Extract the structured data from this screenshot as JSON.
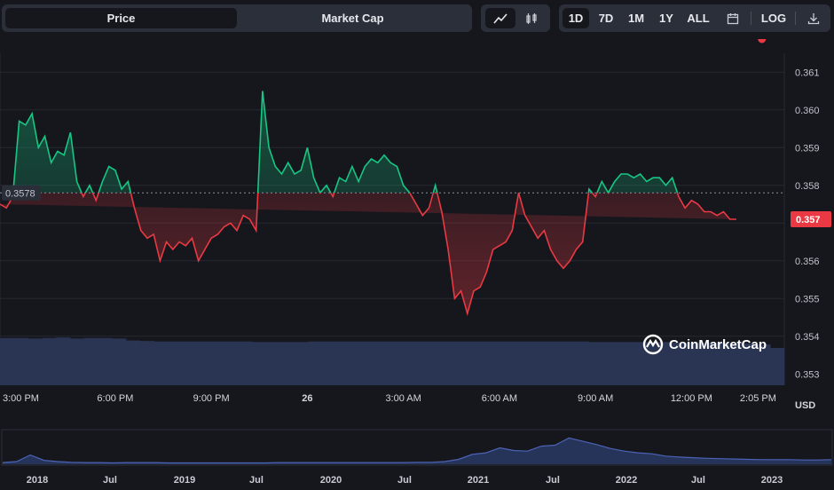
{
  "toolbar": {
    "price_tab": "Price",
    "market_cap_tab": "Market Cap",
    "range_buttons": [
      "1D",
      "7D",
      "1M",
      "1Y",
      "ALL"
    ],
    "active_range": "1D",
    "log_label": "LOG",
    "icons": [
      "line-chart-icon",
      "candlestick-icon",
      "calendar-icon",
      "download-icon"
    ]
  },
  "chart_data": {
    "type": "line",
    "ylim": [
      0.3527,
      0.3615
    ],
    "y_ticks": [
      "0.353",
      "0.354",
      "0.355",
      "0.356",
      "0.357",
      "0.358",
      "0.359",
      "0.360",
      "0.361"
    ],
    "y_tick_values": [
      0.353,
      0.354,
      0.355,
      0.356,
      0.357,
      0.358,
      0.359,
      0.36,
      0.361
    ],
    "x_tick_labels": [
      "3:00 PM",
      "6:00 PM",
      "9:00 PM",
      "26",
      "3:00 AM",
      "6:00 AM",
      "9:00 AM",
      "12:00 PM",
      "2:05 PM"
    ],
    "x_tick_hours": [
      0,
      3,
      6,
      9,
      12,
      15,
      18,
      21,
      23.08
    ],
    "x_range_hours": [
      -0.6,
      23.9
    ],
    "ylabel": "USD",
    "reference_label": "0.3578",
    "reference_value": 0.3578,
    "current_label": "0.357",
    "current_value": 0.3571,
    "up_color": "#16c784",
    "down_color": "#ea3943",
    "x_hours": [
      -0.6,
      -0.4,
      -0.2,
      0,
      0.2,
      0.4,
      0.6,
      0.8,
      1.0,
      1.2,
      1.4,
      1.6,
      1.8,
      2.0,
      2.2,
      2.4,
      2.6,
      2.8,
      3.0,
      3.2,
      3.4,
      3.6,
      3.8,
      4.0,
      4.2,
      4.4,
      4.6,
      4.8,
      5.0,
      5.2,
      5.4,
      5.6,
      5.8,
      6.0,
      6.2,
      6.4,
      6.6,
      6.8,
      7.0,
      7.2,
      7.4,
      7.6,
      7.8,
      8.0,
      8.2,
      8.4,
      8.6,
      8.8,
      9.0,
      9.2,
      9.4,
      9.6,
      9.8,
      10.0,
      10.2,
      10.4,
      10.6,
      10.8,
      11.0,
      11.2,
      11.4,
      11.6,
      11.8,
      12.0,
      12.2,
      12.4,
      12.6,
      12.8,
      13.0,
      13.2,
      13.4,
      13.6,
      13.8,
      14.0,
      14.2,
      14.4,
      14.6,
      14.8,
      15.0,
      15.2,
      15.4,
      15.6,
      15.8,
      16.0,
      16.2,
      16.4,
      16.6,
      16.8,
      17.0,
      17.2,
      17.4,
      17.6,
      17.8,
      18.0,
      18.2,
      18.4,
      18.6,
      18.8,
      19.0,
      19.2,
      19.4,
      19.6,
      19.8,
      20.0,
      20.2,
      20.4,
      20.6,
      20.8,
      21.0,
      21.2,
      21.4,
      21.6,
      21.8,
      22.0,
      22.2,
      22.4,
      22.6,
      22.8,
      23.0,
      23.2
    ],
    "price": [
      0.3575,
      0.3574,
      0.3577,
      0.3597,
      0.3596,
      0.3599,
      0.359,
      0.3593,
      0.3586,
      0.3589,
      0.3588,
      0.3594,
      0.3581,
      0.3577,
      0.358,
      0.3576,
      0.3581,
      0.3585,
      0.3584,
      0.3579,
      0.3581,
      0.3574,
      0.3568,
      0.3566,
      0.3567,
      0.356,
      0.3565,
      0.3563,
      0.3565,
      0.3564,
      0.3566,
      0.356,
      0.3563,
      0.3566,
      0.3567,
      0.3569,
      0.357,
      0.3568,
      0.3572,
      0.3571,
      0.3568,
      0.3605,
      0.359,
      0.3585,
      0.3583,
      0.3586,
      0.3583,
      0.3584,
      0.359,
      0.3582,
      0.3578,
      0.358,
      0.3577,
      0.3582,
      0.3581,
      0.3585,
      0.3581,
      0.3585,
      0.3587,
      0.3586,
      0.3588,
      0.3586,
      0.3585,
      0.358,
      0.3578,
      0.3575,
      0.3572,
      0.3574,
      0.358,
      0.3573,
      0.3563,
      0.355,
      0.3552,
      0.3546,
      0.3552,
      0.3553,
      0.3557,
      0.3563,
      0.3564,
      0.3565,
      0.3568,
      0.3578,
      0.3572,
      0.3569,
      0.3566,
      0.3568,
      0.3563,
      0.356,
      0.3558,
      0.356,
      0.3563,
      0.3565,
      0.3579,
      0.3577,
      0.3581,
      0.3578,
      0.3581,
      0.3583,
      0.3583,
      0.3582,
      0.3583,
      0.3581,
      0.3582,
      0.3582,
      0.358,
      0.3582,
      0.3577,
      0.3574,
      0.3576,
      0.3575,
      0.3573,
      0.3573,
      0.3572,
      0.3573,
      0.3571,
      0.3571
    ],
    "volume_bars": [
      0.95,
      0.95,
      0.94,
      0.95,
      0.96,
      0.94,
      0.95,
      0.95,
      0.94,
      0.9,
      0.89,
      0.88,
      0.88,
      0.88,
      0.88,
      0.88,
      0.88,
      0.88,
      0.87,
      0.87,
      0.87,
      0.87,
      0.88,
      0.88,
      0.88,
      0.88,
      0.88,
      0.88,
      0.88,
      0.88,
      0.88,
      0.88,
      0.88,
      0.88,
      0.88,
      0.88,
      0.88,
      0.88,
      0.88,
      0.88,
      0.88,
      0.88,
      0.87,
      0.87,
      0.87,
      0.87,
      0.87,
      0.87,
      0.86,
      0.86,
      0.86,
      0.86,
      0.85,
      0.84,
      0.82,
      0.75
    ]
  },
  "watermark": "CoinMarketCap",
  "navigator": {
    "labels": [
      "2018",
      "Jul",
      "2019",
      "Jul",
      "2020",
      "Jul",
      "2021",
      "Jul",
      "2022",
      "Jul",
      "2023"
    ],
    "values": [
      0.05,
      0.08,
      0.28,
      0.12,
      0.08,
      0.06,
      0.05,
      0.05,
      0.04,
      0.05,
      0.05,
      0.05,
      0.04,
      0.04,
      0.04,
      0.04,
      0.04,
      0.04,
      0.04,
      0.04,
      0.05,
      0.05,
      0.05,
      0.05,
      0.05,
      0.05,
      0.05,
      0.05,
      0.05,
      0.05,
      0.06,
      0.06,
      0.08,
      0.15,
      0.3,
      0.35,
      0.5,
      0.42,
      0.4,
      0.55,
      0.58,
      0.8,
      0.7,
      0.6,
      0.48,
      0.4,
      0.35,
      0.32,
      0.25,
      0.22,
      0.2,
      0.18,
      0.17,
      0.16,
      0.15,
      0.14,
      0.14,
      0.14,
      0.13,
      0.13,
      0.14
    ]
  }
}
